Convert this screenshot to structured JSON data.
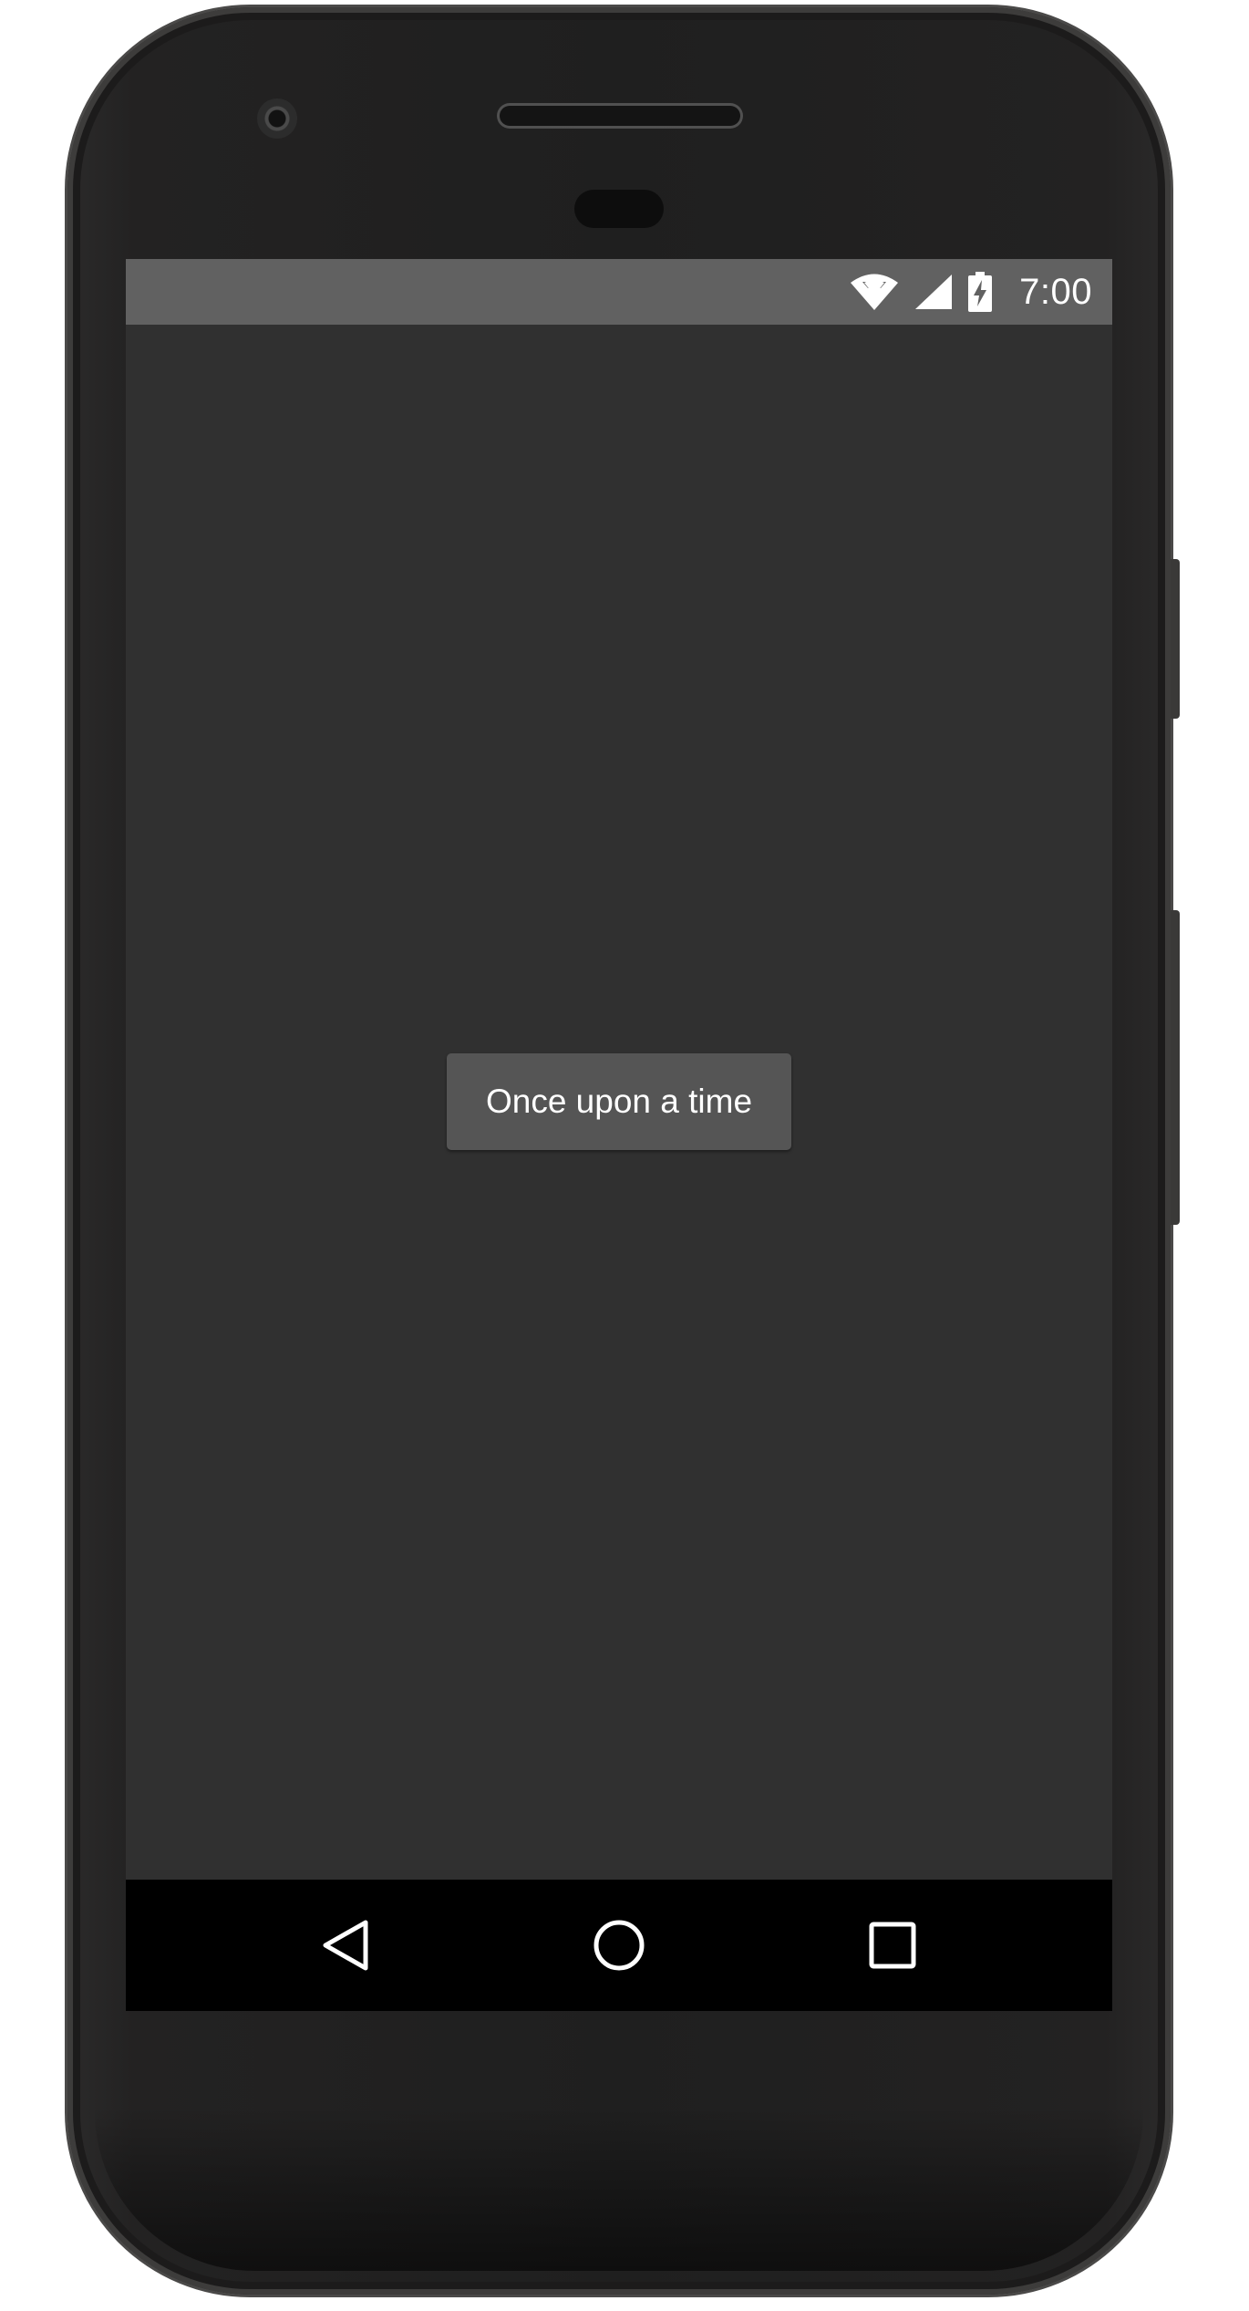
{
  "status_bar": {
    "time": "7:00",
    "icons": [
      "wifi-icon",
      "cell-signal-icon",
      "battery-charging-icon"
    ]
  },
  "main": {
    "button_label": "Once upon a time"
  },
  "nav_bar": {
    "icons": [
      "back-icon",
      "home-icon",
      "recents-icon"
    ]
  },
  "colors": {
    "status_bar_bg": "#616161",
    "screen_bg": "#303030",
    "button_bg": "#555555",
    "button_text": "#ffffff",
    "nav_bar_bg": "#000000",
    "device_body": "#1f1f1f"
  }
}
